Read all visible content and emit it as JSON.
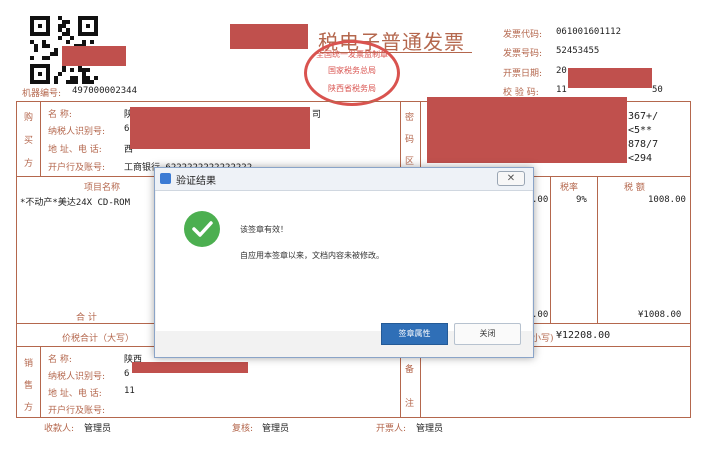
{
  "invoice": {
    "title": "税电子普通发票",
    "machine_no_label": "机器编号:",
    "machine_no": "497000002344",
    "code_label": "发票代码:",
    "code": "061001601112",
    "number_label": "发票号码:",
    "number": "52453455",
    "date_label": "开票日期:",
    "date_partial": "20",
    "check_label": "校 验 码:",
    "check_partial_left": "11",
    "check_partial_right": "50",
    "stamp_lines": [
      "全国统一发票监制章",
      "国家税务总局",
      "陕西省税务局"
    ],
    "buyer": {
      "side_label": [
        "购",
        "买",
        "方"
      ],
      "name_label": "名 称:",
      "name_partial": "陕",
      "name_suffix": "司",
      "tax_id_label": "纳税人识别号:",
      "tax_id_partial": "6",
      "address_label": "地 址、电 话:",
      "address_partial": "西",
      "bank_label": "开户行及账号:",
      "bank_value": "工商银行 6222222222222222"
    },
    "password_area_label": [
      "密",
      "码",
      "区"
    ],
    "password_lines": [
      "367+/",
      "<5**",
      "878/7",
      "<294"
    ],
    "items_header": "项目名称",
    "tax_rate_header": "税率",
    "tax_amount_header": "税 额",
    "item_name": "*不动产*美达24X CD-ROM",
    "item_amount_partial": ".00",
    "item_rate": "9%",
    "item_tax": "1008.00",
    "subtotal_label": "合 计",
    "subtotal_amount_partial": ".00",
    "subtotal_tax": "¥1008.00",
    "total_label": "价税合计（大写）",
    "total_small_label": "小写)",
    "total_small": "¥12208.00",
    "seller": {
      "side_label": [
        "销",
        "售",
        "方"
      ],
      "name_label": "名 称:",
      "name_partial": "陕西",
      "tax_id_label": "纳税人识别号:",
      "tax_id_partial": "6",
      "address_label": "地 址、电 话:",
      "address_partial": "11",
      "bank_label": "开户行及账号:"
    },
    "remark_label": [
      "备",
      "注"
    ],
    "payee_label": "收款人:",
    "payee": "管理员",
    "reviewer_label": "复核:",
    "reviewer": "管理员",
    "drawer_label": "开票人:",
    "drawer": "管理员"
  },
  "dialog": {
    "title": "验证结果",
    "close_glyph": "✕",
    "message_primary": "该签章有效！",
    "message_secondary": "自应用本签章以来，文档内容未被修改。",
    "properties_button": "签章属性",
    "close_button": "关闭"
  }
}
